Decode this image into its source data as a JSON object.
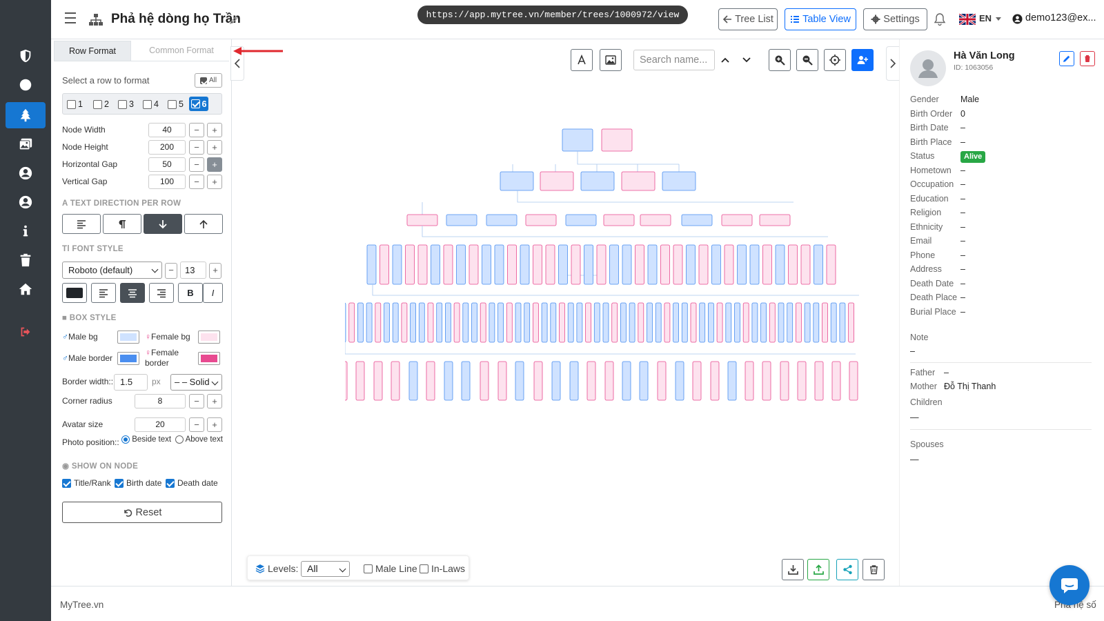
{
  "header": {
    "title": "Phả hệ dòng họ Trần",
    "url": "https://app.mytree.vn/member/trees/1000972/view",
    "tree_list_label": "Tree List",
    "table_view_label": "Table View",
    "settings_label": "Settings",
    "language": "EN",
    "user": "demo123@ex..."
  },
  "sidebar_icons": [
    "shield-icon",
    "circle-icon",
    "tree-icon",
    "gallery-icon",
    "user-circle-icon",
    "user-circle-icon",
    "info-icon",
    "trash-icon",
    "home-icon",
    "logout-icon"
  ],
  "left_panel": {
    "tab_row_format": "Row Format",
    "tab_common_format": "Common Format",
    "select_row_label": "Select a row to format",
    "all_label": "All",
    "rows": [
      {
        "label": "1",
        "checked": false
      },
      {
        "label": "2",
        "checked": false
      },
      {
        "label": "3",
        "checked": false
      },
      {
        "label": "4",
        "checked": false
      },
      {
        "label": "5",
        "checked": false
      },
      {
        "label": "6",
        "checked": true
      }
    ],
    "node_width_label": "Node Width",
    "node_width": "40",
    "node_height_label": "Node Height",
    "node_height": "200",
    "horizontal_gap_label": "Horizontal Gap",
    "horizontal_gap": "50",
    "vertical_gap_label": "Vertical Gap",
    "vertical_gap": "100",
    "text_direction_title": "TEXT DIRECTION PER ROW",
    "font_style_title": "FONT STYLE",
    "font_family": "Roboto (default)",
    "font_size": "13",
    "bold_label": "B",
    "italic_label": "I",
    "box_style_title": "BOX STYLE",
    "male_bg_label": "Male bg",
    "female_bg_label": "Female bg",
    "male_border_label": "Male border",
    "female_border_label_1": "Female",
    "female_border_label_2": "border",
    "border_width_label": "Border width::",
    "border_width": "1.5",
    "px_label": "px",
    "border_style": "– – Solid",
    "corner_radius_label": "Corner radius",
    "corner_radius": "8",
    "avatar_size_label": "Avatar size",
    "avatar_size": "20",
    "photo_position_label": "Photo position::",
    "beside_text_label": "Beside text",
    "above_text_label": "Above text",
    "show_on_node_title": "SHOW ON NODE",
    "title_rank_label": "Title/Rank",
    "birth_date_label": "Birth date",
    "death_date_label": "Death date",
    "reset_label": "Reset",
    "colors": {
      "male_bg": "#cfe2ff",
      "female_bg": "#fde2ee",
      "male_border": "#4a8ef0",
      "female_border": "#e84a90"
    }
  },
  "canvas": {
    "search_placeholder": "Search name...",
    "levels_label": "Levels:",
    "levels_value": "All",
    "male_line_label": "Male Line",
    "in_laws_label": "In-Laws"
  },
  "person": {
    "name": "Hà Văn Long",
    "id": "ID: 1063056",
    "fields": [
      {
        "key": "Gender",
        "value": "Male"
      },
      {
        "key": "Birth Order",
        "value": "0"
      },
      {
        "key": "Birth Date",
        "value": "–"
      },
      {
        "key": "Birth Place",
        "value": "–"
      },
      {
        "key": "Status",
        "value": "Alive"
      },
      {
        "key": "Hometown",
        "value": "–"
      },
      {
        "key": "Occupation",
        "value": "–"
      },
      {
        "key": "Education",
        "value": "–"
      },
      {
        "key": "Religion",
        "value": "–"
      },
      {
        "key": "Ethnicity",
        "value": "–"
      },
      {
        "key": "Email",
        "value": "–"
      },
      {
        "key": "Phone",
        "value": "–"
      },
      {
        "key": "Address",
        "value": "–"
      },
      {
        "key": "Death Date",
        "value": "–"
      },
      {
        "key": "Death Place",
        "value": "–"
      },
      {
        "key": "Burial Place",
        "value": "–"
      }
    ],
    "note_label": "Note",
    "note_value": "–",
    "father_label": "Father",
    "father_value": "–",
    "mother_label": "Mother",
    "mother_value": "Đỗ Thị Thanh",
    "children_label": "Children",
    "children_value": "—",
    "spouses_label": "Spouses",
    "spouses_value": "—"
  },
  "footer": {
    "left": "MyTree.vn",
    "right": "Phả hệ số"
  }
}
